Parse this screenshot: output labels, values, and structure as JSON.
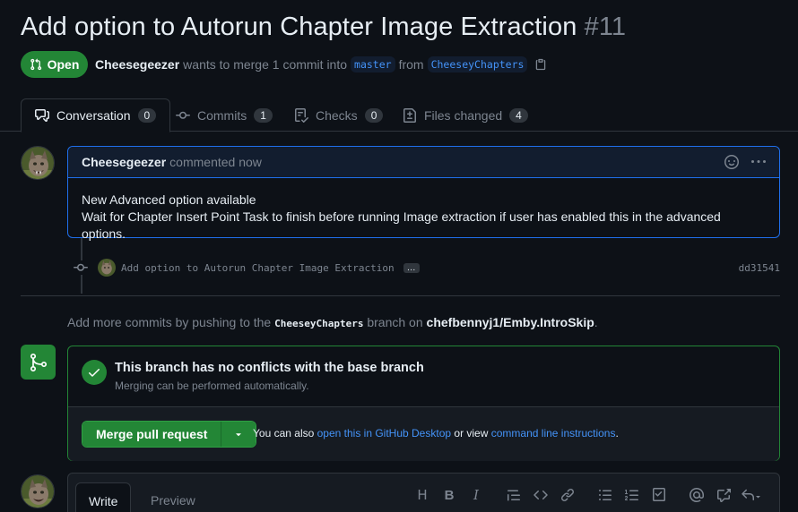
{
  "pr": {
    "title": "Add option to Autorun Chapter Image Extraction",
    "number": "#11",
    "state": "Open",
    "author": "Cheesegeezer",
    "merge_text_1": "wants to merge 1 commit into",
    "base_branch": "master",
    "from_text": "from",
    "head_branch": "CheeseyChapters"
  },
  "tabs": [
    {
      "label": "Conversation",
      "count": "0"
    },
    {
      "label": "Commits",
      "count": "1"
    },
    {
      "label": "Checks",
      "count": "0"
    },
    {
      "label": "Files changed",
      "count": "4"
    }
  ],
  "comment": {
    "author": "Cheesegeezer",
    "action": "commented now",
    "line1": "New Advanced option available",
    "line2": "Wait for Chapter Insert Point Task to finish before running Image extraction if user has enabled this in the advanced options."
  },
  "commit": {
    "message": "Add option to Autorun Chapter Image Extraction",
    "ellipsis": "…",
    "sha": "dd31541"
  },
  "hint": {
    "prefix": "Add more commits by pushing to the",
    "branch": "CheeseyChapters",
    "mid": "branch on",
    "repo": "chefbennyj1/Emby.IntroSkip",
    "suffix": "."
  },
  "merge": {
    "title": "This branch has no conflicts with the base branch",
    "subtitle": "Merging can be performed automatically.",
    "button": "Merge pull request",
    "also_prefix": "You can also",
    "desktop_link": "open this in GitHub Desktop",
    "or_text": "or view",
    "cli_link": "command line instructions",
    "also_suffix": "."
  },
  "editor": {
    "write_tab": "Write",
    "preview_tab": "Preview",
    "toolbar": [
      "H",
      "B",
      "I"
    ]
  },
  "colors": {
    "background": "#0d1117",
    "open_green": "#238636",
    "link_blue": "#4493f8",
    "comment_border": "#1f6feb"
  }
}
